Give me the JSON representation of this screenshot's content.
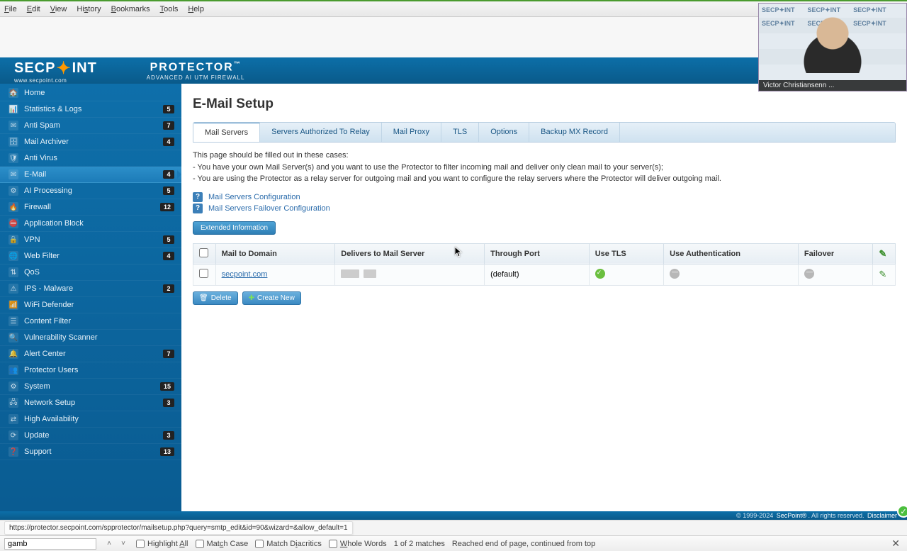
{
  "browser_menu": [
    "File",
    "Edit",
    "View",
    "History",
    "Bookmarks",
    "Tools",
    "Help"
  ],
  "video": {
    "brand": "SECP✦INT",
    "caption": "Victor Christiansenn ..."
  },
  "branding": {
    "logo": "SECP",
    "logo2": "INT",
    "logo_sub": "www.secpoint.com",
    "product": "PROTECTOR",
    "product_tm": "™",
    "product_sub": "ADVANCED AI UTM FIREWALL"
  },
  "sidebar": [
    {
      "label": "Home",
      "badge": null,
      "active": false,
      "icon": "🏠"
    },
    {
      "label": "Statistics & Logs",
      "badge": "5",
      "active": false,
      "icon": "📊"
    },
    {
      "label": "Anti Spam",
      "badge": "7",
      "active": false,
      "icon": "✉"
    },
    {
      "label": "Mail Archiver",
      "badge": "4",
      "active": false,
      "icon": "🗄"
    },
    {
      "label": "Anti Virus",
      "badge": null,
      "active": false,
      "icon": "🛡"
    },
    {
      "label": "E-Mail",
      "badge": "4",
      "active": true,
      "icon": "✉"
    },
    {
      "label": "AI Processing",
      "badge": "5",
      "active": false,
      "icon": "⚙"
    },
    {
      "label": "Firewall",
      "badge": "12",
      "active": false,
      "icon": "🔥"
    },
    {
      "label": "Application Block",
      "badge": null,
      "active": false,
      "icon": "⛔"
    },
    {
      "label": "VPN",
      "badge": "5",
      "active": false,
      "icon": "🔒"
    },
    {
      "label": "Web Filter",
      "badge": "4",
      "active": false,
      "icon": "🌐"
    },
    {
      "label": "QoS",
      "badge": null,
      "active": false,
      "icon": "⇅"
    },
    {
      "label": "IPS - Malware",
      "badge": "2",
      "active": false,
      "icon": "⚠"
    },
    {
      "label": "WiFi Defender",
      "badge": null,
      "active": false,
      "icon": "📶"
    },
    {
      "label": "Content Filter",
      "badge": null,
      "active": false,
      "icon": "☰"
    },
    {
      "label": "Vulnerability Scanner",
      "badge": null,
      "active": false,
      "icon": "🔍"
    },
    {
      "label": "Alert Center",
      "badge": "7",
      "active": false,
      "icon": "🔔"
    },
    {
      "label": "Protector Users",
      "badge": null,
      "active": false,
      "icon": "👥"
    },
    {
      "label": "System",
      "badge": "15",
      "active": false,
      "icon": "⚙"
    },
    {
      "label": "Network Setup",
      "badge": "3",
      "active": false,
      "icon": "🖧"
    },
    {
      "label": "High Availability",
      "badge": null,
      "active": false,
      "icon": "⇄"
    },
    {
      "label": "Update",
      "badge": "3",
      "active": false,
      "icon": "⟳"
    },
    {
      "label": "Support",
      "badge": "13",
      "active": false,
      "icon": "❓"
    }
  ],
  "page": {
    "title": "E-Mail Setup",
    "tabs": [
      "Mail Servers",
      "Servers Authorized To Relay",
      "Mail Proxy",
      "TLS",
      "Options",
      "Backup MX Record"
    ],
    "active_tab": 0,
    "desc_intro": "This page should be filled out in these cases:",
    "desc_b1": "- You have your own Mail Server(s) and you want to use the Protector to filter incoming mail and deliver only clean mail to your server(s);",
    "desc_b2": "- You are using the Protector as a relay server for outgoing mail and you want to configure the relay servers where the Protector will deliver outgoing mail.",
    "help_links": [
      "Mail Servers Configuration",
      "Mail Servers Failover Configuration"
    ],
    "ext_btn": "Extended Information",
    "table": {
      "headers": [
        "",
        "Mail to Domain",
        "Delivers to Mail Server",
        "Through Port",
        "Use TLS",
        "Use Authentication",
        "Failover",
        ""
      ],
      "rows": [
        {
          "domain": "secpoint.com",
          "port": "(default)",
          "tls": true,
          "auth": false,
          "failover": false
        }
      ]
    },
    "btn_delete": "Delete",
    "btn_create": "Create New"
  },
  "footer": {
    "copyright": "© 1999-2024",
    "brand": "SecPoint®",
    "rights": ". All rights reserved.",
    "disclaimer": "Disclaimer"
  },
  "status_url": "https://protector.secpoint.com/spprotector/mailsetup.php?query=smtp_edit&id=90&wizard=&allow_default=1",
  "findbar": {
    "query": "gamb",
    "highlight": "Highlight All",
    "matchcase": "Match Case",
    "diacritics": "Match Diacritics",
    "whole": "Whole Words",
    "count": "1 of 2 matches",
    "status": "Reached end of page, continued from top"
  }
}
